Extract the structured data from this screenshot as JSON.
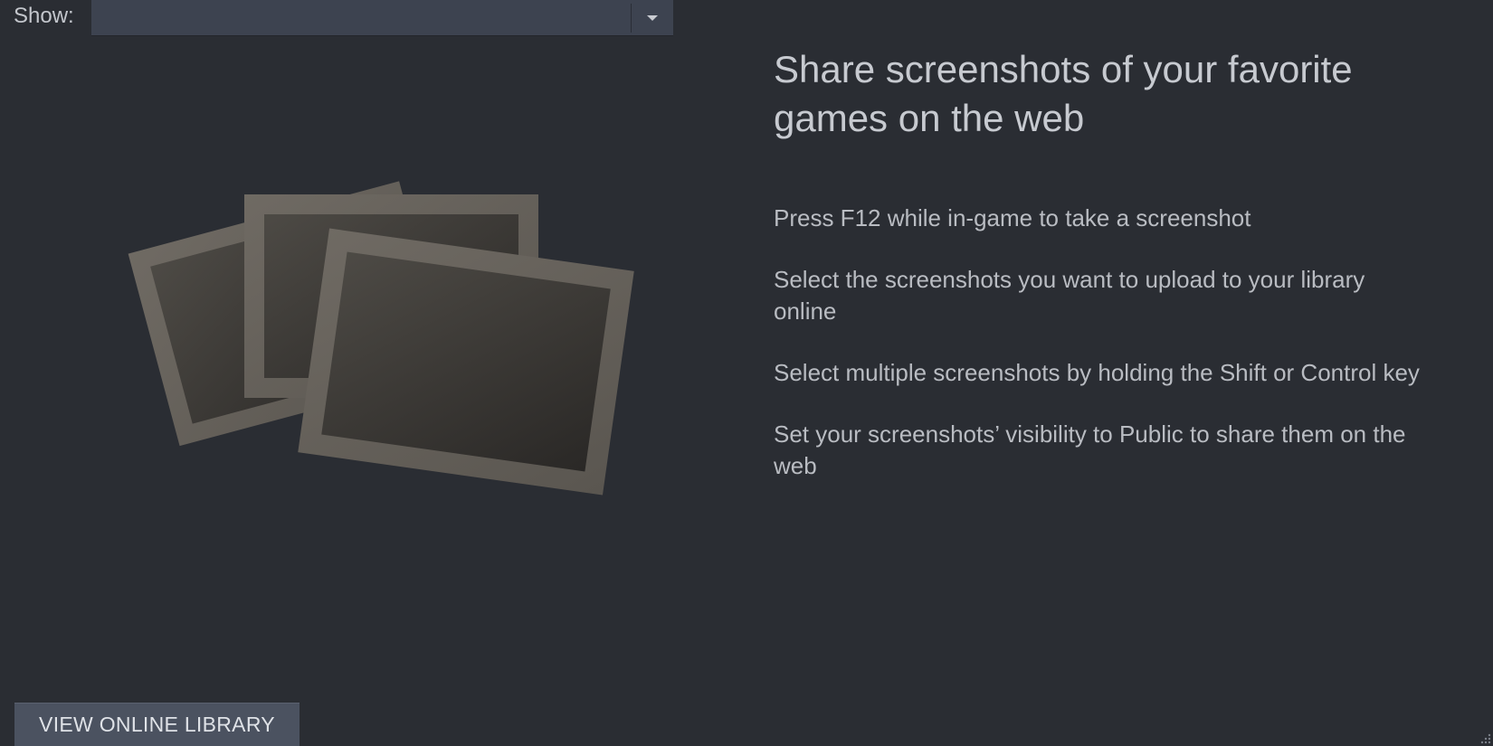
{
  "filter": {
    "label": "Show:",
    "selected_value": "",
    "dropdown_icon": "chevron-down-icon"
  },
  "headline": "Share screenshots of your favorite games on the web",
  "tips": [
    "Press F12 while in-game to take a screenshot",
    "Select the screenshots you want to upload to your library online",
    "Select multiple screenshots by holding the Shift or Control key",
    "Set your screenshots’ visibility to Public to share them on the web"
  ],
  "button": {
    "label": "VIEW ONLINE LIBRARY"
  },
  "colors": {
    "background": "#2a2d33",
    "dropdown": "#3d4350",
    "button": "#4b5260",
    "text": "#c7cad0"
  }
}
